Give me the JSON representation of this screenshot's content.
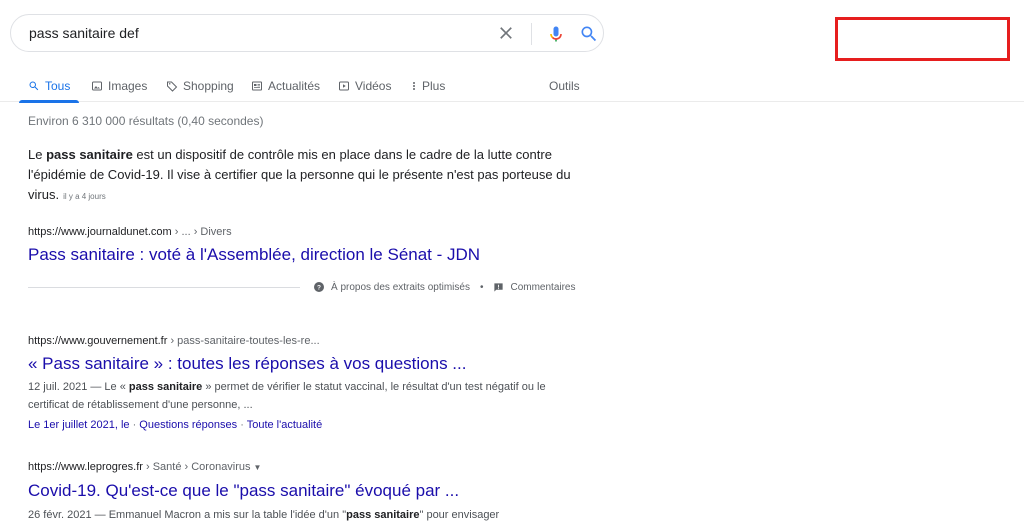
{
  "search": {
    "query": "pass sanitaire def"
  },
  "tabs": [
    {
      "label": "Tous"
    },
    {
      "label": "Images"
    },
    {
      "label": "Shopping"
    },
    {
      "label": "Actualités"
    },
    {
      "label": "Vidéos"
    },
    {
      "label": "Plus"
    }
  ],
  "tools_label": "Outils",
  "stats": "Environ 6 310 000 résultats (0,40 secondes)",
  "featured": {
    "text_before": "Le ",
    "bold": "pass sanitaire",
    "text_after": " est un dispositif de contrôle mis en place dans le cadre de la lutte contre l'épidémie de Covid-19. Il vise à certifier que la personne qui le présente n'est pas porteuse du virus.",
    "date": "il y a 4 jours",
    "url_domain": "https://www.journaldunet.com",
    "url_path": " › ... › Divers",
    "title": "Pass sanitaire : voté à l'Assemblée, direction le Sénat - JDN",
    "about_label": "À propos des extraits optimisés",
    "feedback_label": "Commentaires"
  },
  "results": [
    {
      "url_domain": "https://www.gouvernement.fr",
      "url_path": " › pass-sanitaire-toutes-les-re...",
      "title": "« Pass sanitaire » : toutes les réponses à vos questions ...",
      "desc_date": "12 juil. 2021 — Le « ",
      "desc_bold": "pass sanitaire",
      "desc_rest": " » permet de vérifier le statut vaccinal, le résultat d'un test négatif ou le certificat de rétablissement d'une personne, ...",
      "sitelinks": [
        "Le 1er juillet 2021, le",
        "Questions réponses",
        "Toute l'actualité"
      ]
    },
    {
      "url_domain": "https://www.leprogres.fr",
      "url_path": " › Santé › Coronavirus",
      "title": "Covid-19. Qu'est-ce que le \"pass sanitaire\" évoqué par ...",
      "desc_date": "26 févr. 2021 — Emmanuel Macron a mis sur la table l'idée d'un \"",
      "desc_bold": "pass sanitaire",
      "desc_rest": "\" pour envisager"
    }
  ],
  "colors": {
    "link": "#1a0dab",
    "accent": "#1a73e8",
    "highlight_box": "#e61e1e"
  }
}
